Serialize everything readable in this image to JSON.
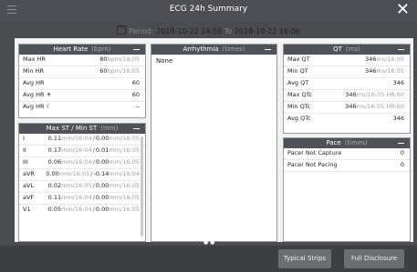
{
  "window": {
    "title": "ECG 24h Summary",
    "close_glyph": "✕"
  },
  "period": {
    "label": "Period:",
    "from": "2018-10-22 14:56",
    "to_word": "To",
    "to": "2018-10-22 16:06"
  },
  "heart_rate": {
    "title": "Heart Rate",
    "unit": "(bpm)",
    "rows": [
      {
        "label": "Max HR",
        "value": "80",
        "unit": "bpm/16:05"
      },
      {
        "label": "Min HR",
        "value": "60",
        "unit": "bpm/16:05"
      },
      {
        "label": "Avg HR",
        "value": "60",
        "unit": ""
      },
      {
        "label": "Avg HR ☀",
        "value": "60",
        "unit": ""
      },
      {
        "label": "Avg HR ☾",
        "value": "--",
        "unit": ""
      }
    ]
  },
  "max_min_st": {
    "title": "Max ST / Min ST",
    "unit": "(mm)",
    "rows": [
      {
        "label": "I",
        "max": "0.11",
        "max_time": "mm/16:04",
        "min": "0.00",
        "min_time": "mm/16:05"
      },
      {
        "label": "II",
        "max": "0.17",
        "max_time": "mm/16:04",
        "min": "0.01",
        "min_time": "mm/16:05"
      },
      {
        "label": "III",
        "max": "0.06",
        "max_time": "mm/16:04",
        "min": "0.00",
        "min_time": "mm/16:05"
      },
      {
        "label": "aVR",
        "max": "0.00",
        "max_time": "mm/16:05",
        "min": "-0.14",
        "min_time": "mm/16:04"
      },
      {
        "label": "aVL",
        "max": "0.02",
        "max_time": "mm/16:05",
        "min": "0.00",
        "min_time": "mm/16:05"
      },
      {
        "label": "aVF",
        "max": "0.11",
        "max_time": "mm/16:04",
        "min": "0.00",
        "min_time": "mm/16:05"
      },
      {
        "label": "V1",
        "max": "0.05",
        "max_time": "mm/16:04",
        "min": "0.00",
        "min_time": "mm/16:05"
      }
    ]
  },
  "arrhythmia": {
    "title": "Arrhythmia",
    "unit": "(times)",
    "value": "None"
  },
  "qt": {
    "title": "QT",
    "unit": "(ms)",
    "rows": [
      {
        "label": "Max QT",
        "value": "346",
        "unit": "ms/16:05"
      },
      {
        "label": "Min QT",
        "value": "346",
        "unit": "ms/16:05"
      },
      {
        "label": "Avg QT",
        "value": "346",
        "unit": ""
      },
      {
        "label": "Max QTc",
        "value": "346",
        "unit": "ms/16:05",
        "extra": "HR:60"
      },
      {
        "label": "Min QTc",
        "value": "346",
        "unit": "ms/16:05",
        "extra": "HR:60"
      },
      {
        "label": "Avg QTc",
        "value": "346",
        "unit": ""
      }
    ]
  },
  "pace": {
    "title": "Pace",
    "unit": "(times)",
    "rows": [
      {
        "label": "Pacer Not Capture",
        "value": "0"
      },
      {
        "label": "Pacer Not Pacing",
        "value": "0"
      }
    ]
  },
  "footer": {
    "buttons": [
      "Typical Strips",
      "Full Disclosure"
    ],
    "page_dots": "● ●"
  }
}
